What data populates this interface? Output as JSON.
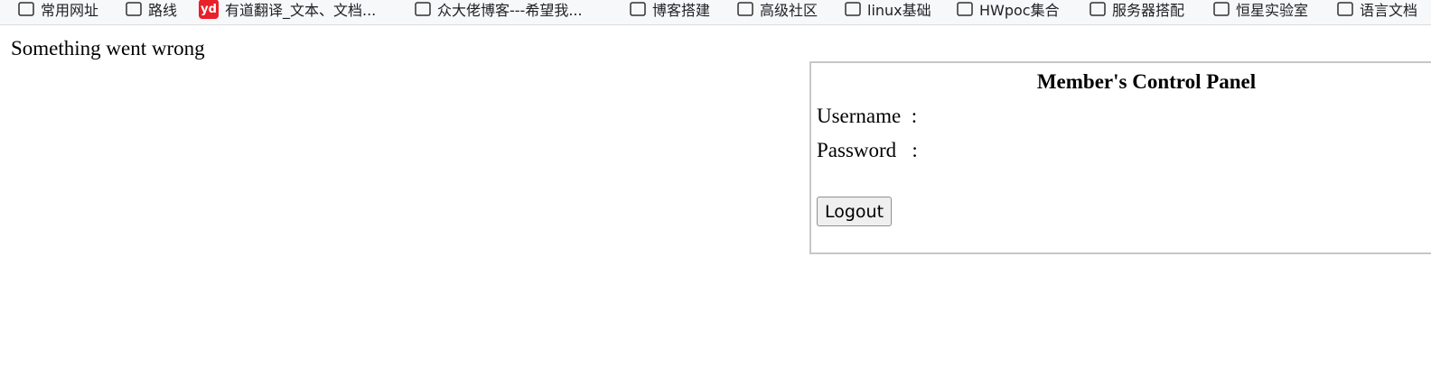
{
  "bookmarks": [
    {
      "label": "常用网址",
      "icon": "folder-icon"
    },
    {
      "label": "路线",
      "icon": "folder-icon"
    },
    {
      "label": "有道翻译_文本、文档...",
      "icon": "youdao-icon",
      "icon_text": "yd",
      "icon_color": "#e8202a"
    },
    {
      "label": "众大佬博客---希望我...",
      "icon": "folder-icon"
    },
    {
      "label": "博客搭建",
      "icon": "folder-icon"
    },
    {
      "label": "高级社区",
      "icon": "folder-icon"
    },
    {
      "label": "linux基础",
      "icon": "folder-icon"
    },
    {
      "label": "HWpoc集合",
      "icon": "folder-icon"
    },
    {
      "label": "服务器搭配",
      "icon": "folder-icon"
    },
    {
      "label": "恒星实验室",
      "icon": "folder-icon"
    },
    {
      "label": "语言文档",
      "icon": "folder-icon"
    }
  ],
  "page": {
    "error_message": "Something went wrong"
  },
  "panel": {
    "title": "Member's Control Panel",
    "username_label": "Username  :",
    "password_label": "Password   :",
    "logout_label": "Logout"
  }
}
